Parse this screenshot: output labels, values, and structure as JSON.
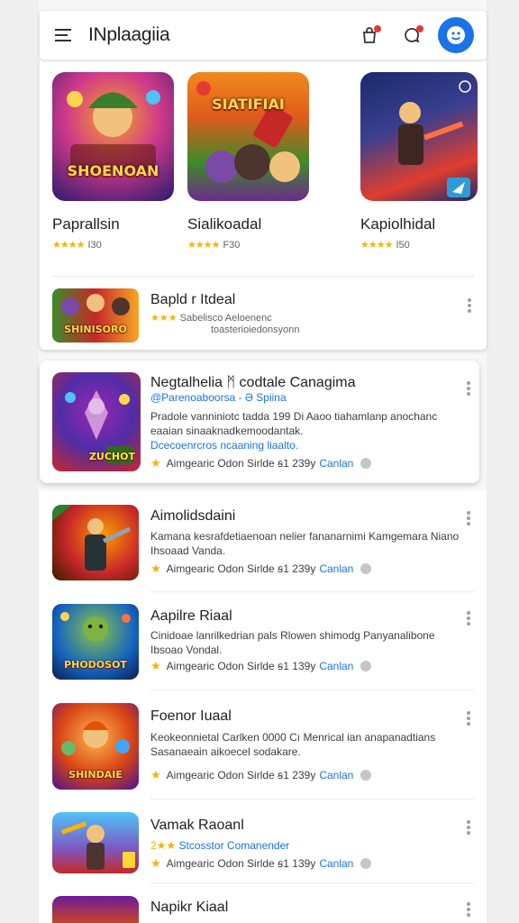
{
  "header": {
    "title": "INplaagiia",
    "icons": [
      "menu-icon",
      "bag-icon",
      "chat-icon",
      "profile-icon"
    ],
    "accent": "#1a73e8"
  },
  "featured": [
    {
      "title": "Paprallsin",
      "stars": "★★★★",
      "rating": "I30",
      "thumb_label": "SHOENOAN",
      "colors": [
        "#2b1a6e",
        "#d23a8a",
        "#f5a623"
      ]
    },
    {
      "title": "Sialikoadal",
      "stars": "★★★★",
      "rating": "F30",
      "thumb_label": "SIATIFIAI",
      "colors": [
        "#f08a1c",
        "#3d8b2a",
        "#6b2a8c"
      ]
    },
    {
      "title": "Kapiolhidal",
      "stars": "★★★★",
      "rating": "I50",
      "thumb_label": "",
      "colors": [
        "#1b2a6b",
        "#e03d2e",
        "#2d9cdb"
      ]
    }
  ],
  "small_item": {
    "title": "Bapld r Itdeal",
    "stars": "★★★",
    "sub1": "Sabelisco Aeloenenc",
    "sub2": "toasterioiedonsyonn",
    "thumb_label": "SHINISORO"
  },
  "highlight": {
    "title": "Negtalhelia ᛗ codtale Canagima",
    "link": "@Parenoaboorsa - Ə Spiina",
    "desc_1": "Pradole vanniniotc tadda 199 Di Aaoo tiahamlanp anochanc",
    "desc_2": "eaaian sinaaknadkemoodantak.",
    "link2": "Dcecoenrcros ncaaning liaalto.",
    "meta": "Aimgearic  Odon  Sirlde  ꞩ1 239y",
    "category": "Canlan",
    "thumb_label": "ZUCHOT"
  },
  "list": [
    {
      "title": "Aimolidsdaini",
      "desc_1": "Kamana kesrafdetiaenoan nelier fananarnimi Kamgemara Niano",
      "desc_2": "Ihsoaad Vanda.",
      "meta": "Aimgearic  Odon  Sirlde  ꞩ1 239y",
      "category": "Canlan",
      "thumb_label": ""
    },
    {
      "title": "Aapilre Riaal",
      "desc_1": "Cinidoae lanrilkedrian pals Rlowen shimodg Panyanalibone",
      "desc_2": "Ibsoao Vondal.",
      "meta": "Aimgearic  Odon  Sirlde  ꞩ1 139y",
      "category": "Canlan",
      "thumb_label": "PHODOSOT"
    },
    {
      "title": "Foenor Iuaal",
      "desc_1": "Keokeonnietal Carlken  0000  Cı Menrical ian anapanadtians",
      "desc_2": "Sasanaeain aikoecel sodakare.",
      "meta": "Aimgearic  Odon  Sirlde  ꞩ1 239y",
      "category": "Canlan",
      "thumb_label": "SHINDAIE"
    },
    {
      "title": "Vamak Raoanl",
      "stars": "2★★",
      "link": "Stcosstor Comanender",
      "meta": "Aimgearic  Odon  Sirlde  ꞩ1 139y",
      "category": "Canlan",
      "thumb_label": ""
    },
    {
      "title": "Napikr Kiaal"
    }
  ]
}
